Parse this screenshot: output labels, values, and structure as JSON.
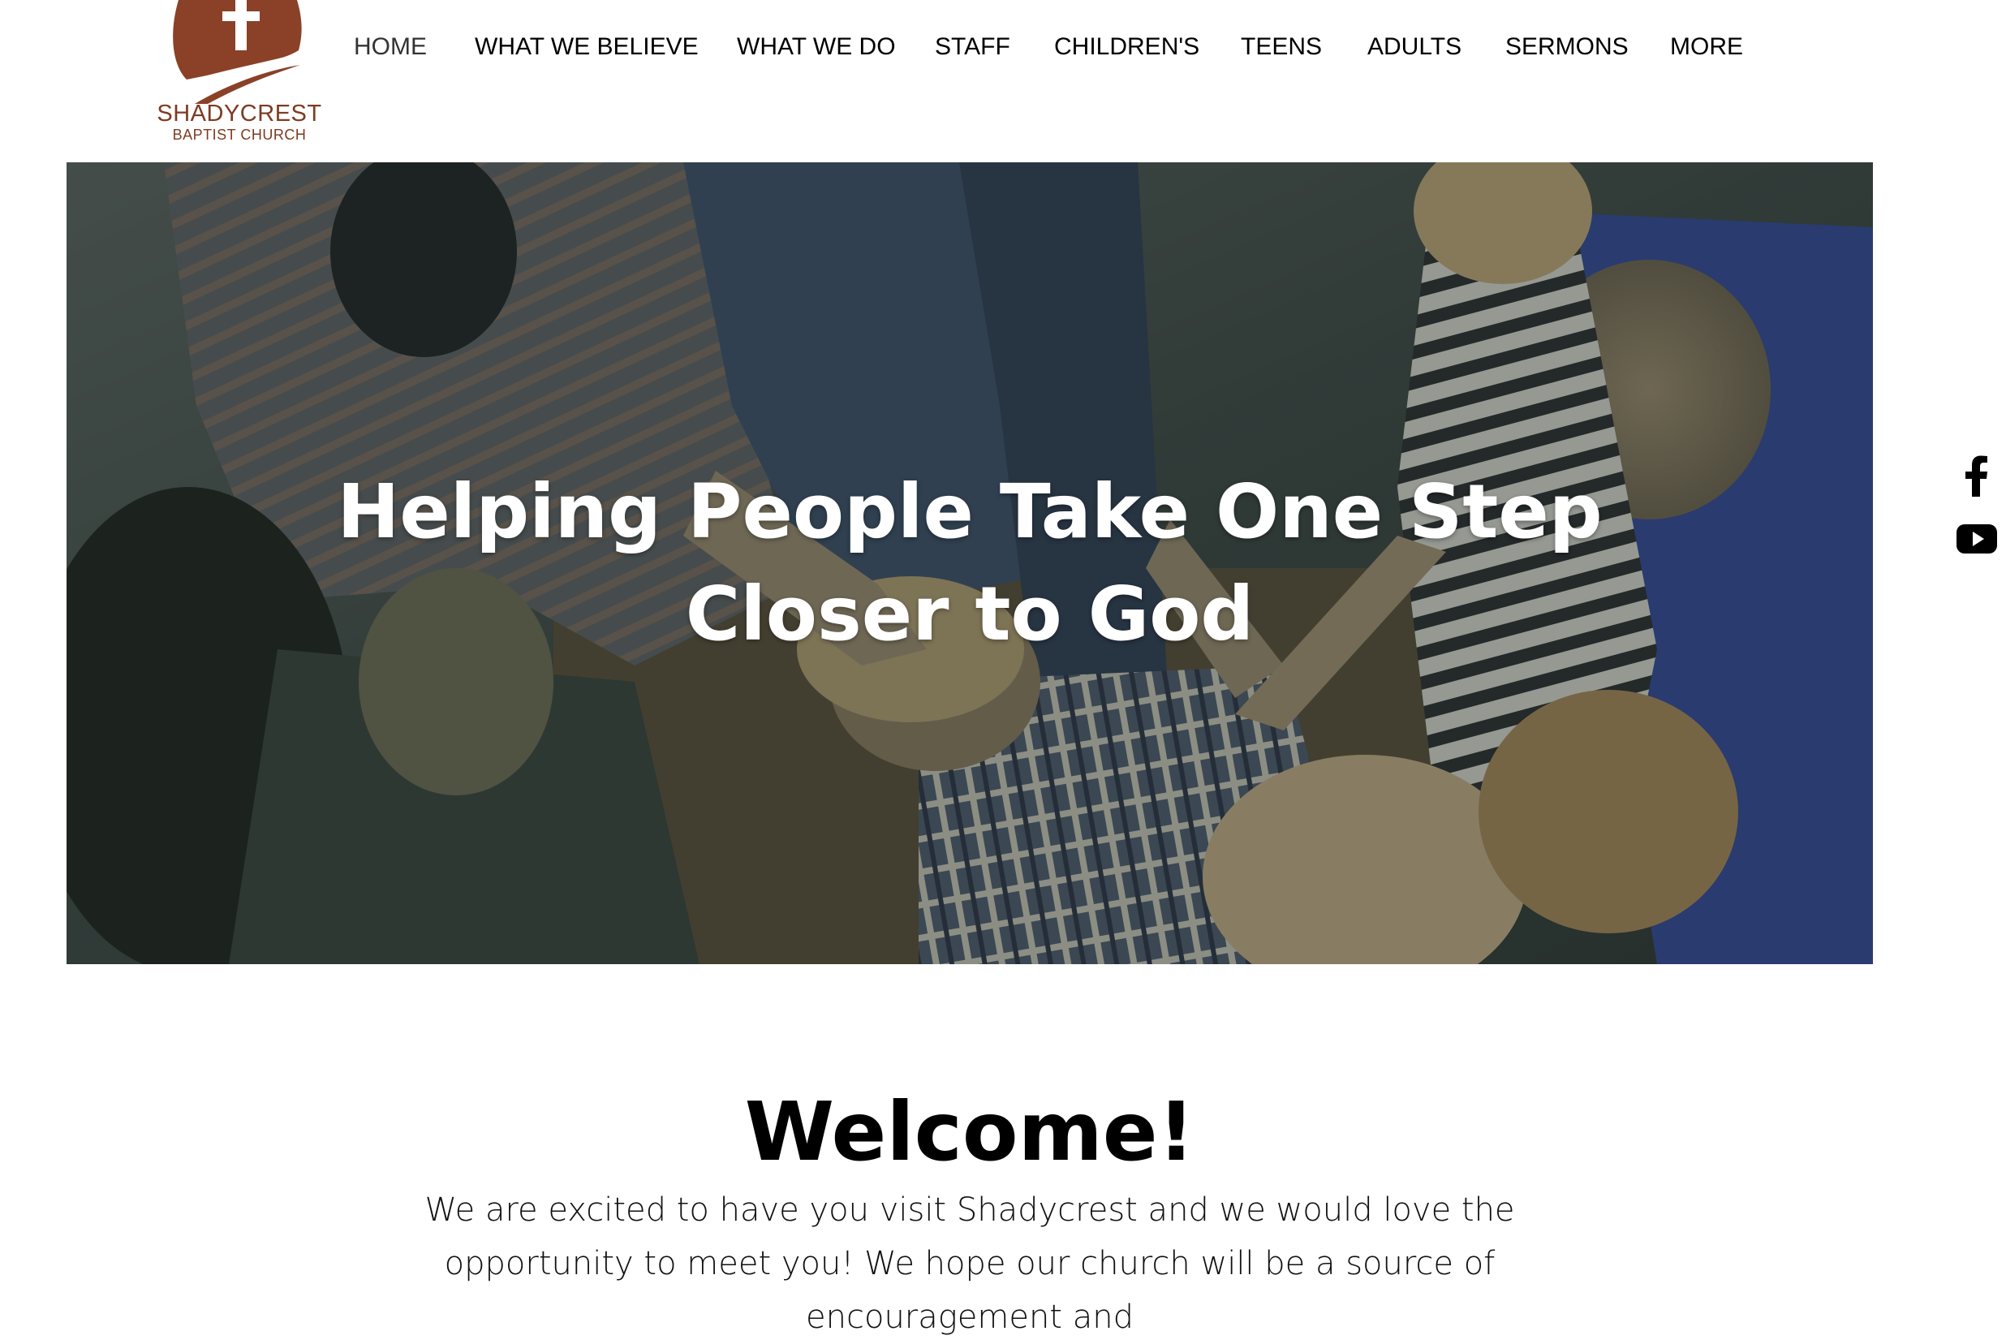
{
  "logo": {
    "name": "SHADYCREST",
    "subtitle": "BAPTIST CHURCH",
    "brand_color": "#8a4128"
  },
  "nav": {
    "items": [
      {
        "label": "HOME",
        "active": true
      },
      {
        "label": "WHAT WE BELIEVE"
      },
      {
        "label": "WHAT WE DO"
      },
      {
        "label": "STAFF"
      },
      {
        "label": "CHILDREN'S"
      },
      {
        "label": "TEENS"
      },
      {
        "label": "ADULTS"
      },
      {
        "label": "SERMONS"
      },
      {
        "label": "MORE"
      }
    ]
  },
  "hero": {
    "line1": "Helping People Take One Step",
    "line2": "Closer to God",
    "image": "people-praying-photo"
  },
  "social": {
    "icons": [
      "facebook-icon",
      "youtube-icon"
    ]
  },
  "welcome": {
    "title": "Welcome!",
    "body": "We are excited to have you visit Shadycrest and we would love the opportunity to meet you! We hope our church will be a source of encouragement and"
  }
}
